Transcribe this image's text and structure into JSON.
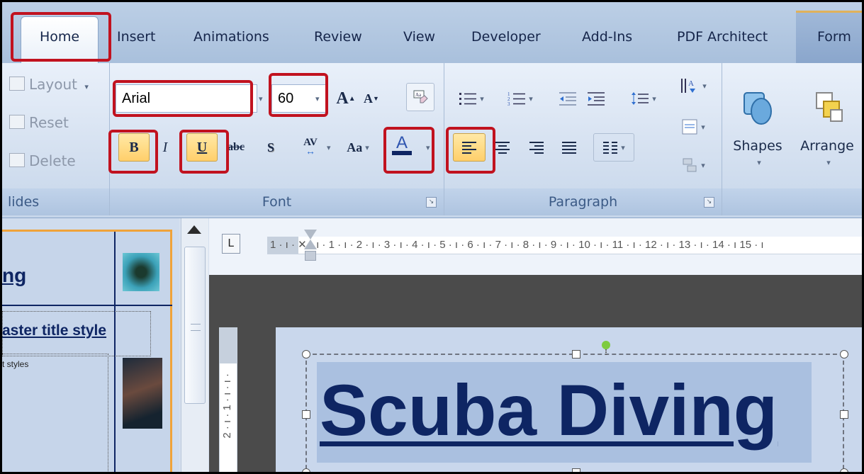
{
  "tabs": [
    "Home",
    "Insert",
    "Animations",
    "Review",
    "View",
    "Developer",
    "Add-Ins",
    "PDF Architect",
    "Form"
  ],
  "slides_group": {
    "label": "lides",
    "layout": "Layout",
    "reset": "Reset",
    "delete": "Delete"
  },
  "font_group": {
    "label": "Font",
    "font_name": "Arial",
    "font_size": "60",
    "grow": "A",
    "shrink": "A",
    "bold": "B",
    "italic": "I",
    "underline": "U",
    "strikethrough": "abc",
    "shadow": "S",
    "spacing": "AV",
    "change_case": "Aa",
    "font_color": "A",
    "font_color_value": "#0e2563"
  },
  "paragraph_group": {
    "label": "Paragraph"
  },
  "drawing_group": {
    "shapes": "Shapes",
    "arrange": "Arrange"
  },
  "thumbnail": {
    "title": "ng",
    "master_title": "aster title style",
    "body_text": "t styles"
  },
  "ruler": {
    "tab_selector": "L",
    "horizontal": "1 · ı · ✕ · ı · 1 · ı · 2 · ı · 3 · ı · 4 · ı · 5 · ı · 6 · ı · 7 · ı · 8 · ı · 9 · ı · 10 · ı · 11 · ı · 12 · ı · 13 · ı · 14 · ı 15 · ı",
    "vertical": "2 · ı · 1 · ı · ı ·"
  },
  "slide": {
    "title": "Scuba Diving",
    "title_color": "#0e2563"
  },
  "colors": {
    "highlight_box": "#c1121f",
    "pressed_button": "#ffcf6b",
    "ribbon": "#d4e0f0"
  }
}
